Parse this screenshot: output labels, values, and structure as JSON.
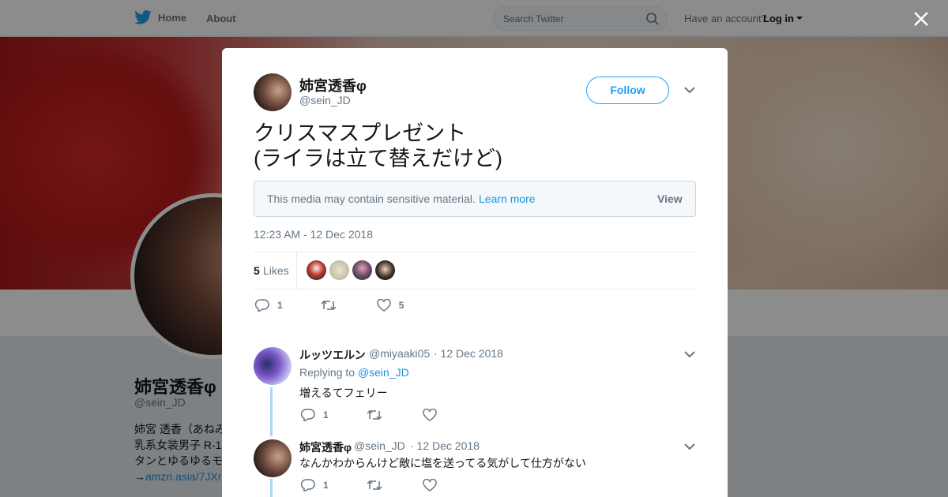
{
  "topnav": {
    "home_label": "Home",
    "about_label": "About",
    "search_placeholder": "Search Twitter",
    "have_account": "Have an account?",
    "login_label": "Log in"
  },
  "profile": {
    "name": "姉宮透香φ",
    "handle": "@sein_JD",
    "bio_lines": [
      "姉宮 透香（あねみ",
      "乳系女装男子 R-1",
      "タンとゆるゆるモ"
    ],
    "bio_link_prefix": "→",
    "bio_link": "amzn.asia/7JXr"
  },
  "tweet": {
    "author_name": "姉宮透香φ",
    "author_handle": "@sein_JD",
    "follow_label": "Follow",
    "text": "クリスマスプレゼント\n(ライラは立て替えだけど)",
    "sensitive_notice": "This media may contain sensitive material.",
    "learn_more": "Learn more",
    "view_label": "View",
    "timestamp": "12:23 AM - 12 Dec 2018",
    "likes_count": "5",
    "likes_label": "Likes",
    "reply_count": "1",
    "like_count": "5"
  },
  "replies": [
    {
      "name": "ルッツエルン",
      "handle": "@miyaaki05",
      "date": "· 12 Dec 2018",
      "replying_to_label": "Replying to",
      "replying_to_handle": "@sein_JD",
      "text": "増えるてフェリー",
      "reply_count": "1"
    },
    {
      "name": "姉宮透香φ",
      "handle": "@sein_JD",
      "date": "· 12 Dec 2018",
      "text": "なんかわからんけど敵に塩を送ってる気がして仕方がない",
      "reply_count": "1"
    }
  ],
  "colors": {
    "accent": "#1da1f2",
    "link": "#1b95e0",
    "muted": "#657786",
    "thread_line": "#a7d7f6"
  }
}
